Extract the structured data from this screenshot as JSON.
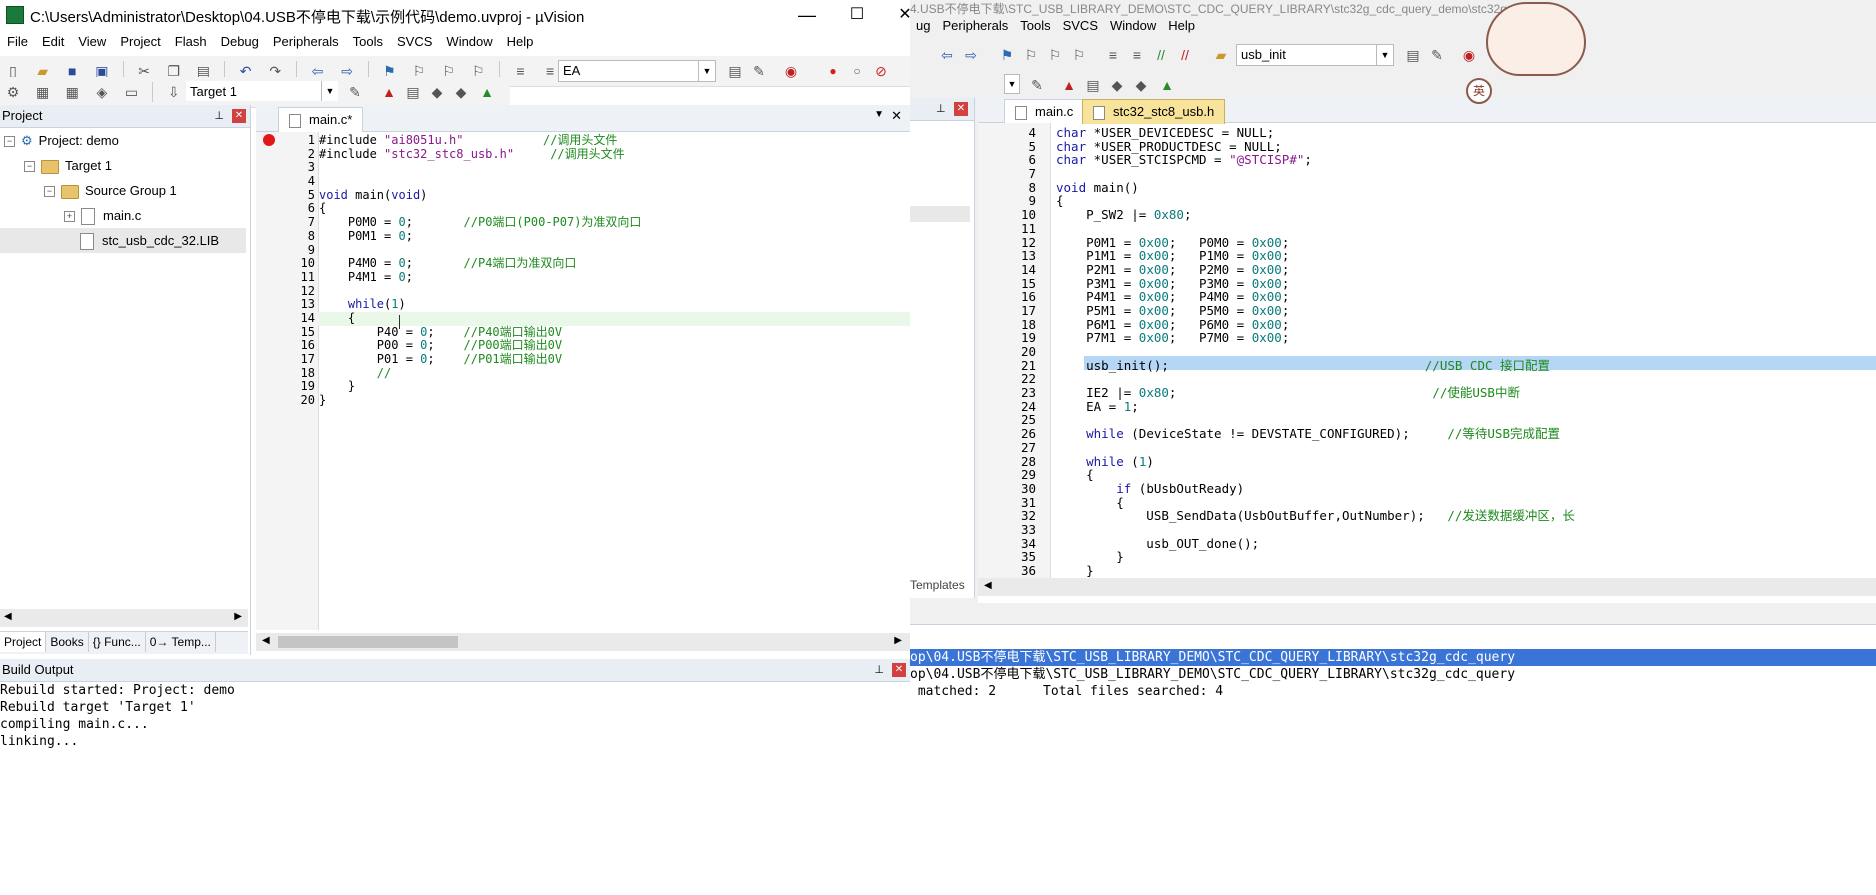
{
  "window": {
    "title": "C:\\Users\\Administrator\\Desktop\\04.USB不停电下载\\示例代码\\demo.uvproj - µVision",
    "minimize": "—",
    "maximize": "☐",
    "close": "✕"
  },
  "menu": [
    "File",
    "Edit",
    "View",
    "Project",
    "Flash",
    "Debug",
    "Peripherals",
    "Tools",
    "SVCS",
    "Window",
    "Help"
  ],
  "toolbar1": {
    "find_value": "EA"
  },
  "toolbar2": {
    "target": "Target 1"
  },
  "project": {
    "title": "Project",
    "root": "Project: demo",
    "target": "Target 1",
    "group": "Source Group 1",
    "files": [
      "main.c",
      "stc_usb_cdc_32.LIB"
    ],
    "bottom_tabs": [
      "Project",
      "Books",
      "{} Func...",
      "0→ Temp..."
    ]
  },
  "editor": {
    "tab": "main.c*",
    "lines": [
      {
        "n": "1",
        "seg": [
          [
            "#include ",
            ""
          ],
          [
            "\"ai8051u.h\"",
            "str"
          ],
          [
            "           //调用头文件",
            "cmt"
          ]
        ]
      },
      {
        "n": "2",
        "seg": [
          [
            "#include ",
            ""
          ],
          [
            "\"stc32_stc8_usb.h\"",
            "str"
          ],
          [
            "     //调用头文件",
            "cmt"
          ]
        ]
      },
      {
        "n": "3",
        "seg": []
      },
      {
        "n": "4",
        "seg": []
      },
      {
        "n": "5",
        "seg": [
          [
            "void",
            "kw"
          ],
          [
            " main(",
            ""
          ],
          [
            "void",
            "kw"
          ],
          [
            ")",
            ""
          ]
        ]
      },
      {
        "n": "6",
        "seg": [
          [
            "{",
            ""
          ]
        ]
      },
      {
        "n": "7",
        "seg": [
          [
            "    P0M0 = ",
            ""
          ],
          [
            "0",
            "num"
          ],
          [
            ";       ",
            ""
          ],
          [
            "//P0端口(P00-P07)为准双向口",
            "cmt"
          ]
        ]
      },
      {
        "n": "8",
        "seg": [
          [
            "    P0M1 = ",
            ""
          ],
          [
            "0",
            "num"
          ],
          [
            ";",
            ""
          ]
        ]
      },
      {
        "n": "9",
        "seg": []
      },
      {
        "n": "10",
        "seg": [
          [
            "    P4M0 = ",
            ""
          ],
          [
            "0",
            "num"
          ],
          [
            ";       ",
            ""
          ],
          [
            "//P4端口为准双向口",
            "cmt"
          ]
        ]
      },
      {
        "n": "11",
        "seg": [
          [
            "    P4M1 = ",
            ""
          ],
          [
            "0",
            "num"
          ],
          [
            ";",
            ""
          ]
        ]
      },
      {
        "n": "12",
        "seg": []
      },
      {
        "n": "13",
        "seg": [
          [
            "    ",
            ""
          ],
          [
            "while",
            "kw"
          ],
          [
            "(",
            ""
          ],
          [
            "1",
            "num"
          ],
          [
            ")",
            ""
          ]
        ]
      },
      {
        "n": "14",
        "seg": [
          [
            "    {",
            ""
          ]
        ]
      },
      {
        "n": "15",
        "seg": [
          [
            "        P40 = ",
            ""
          ],
          [
            "0",
            "num"
          ],
          [
            ";    ",
            ""
          ],
          [
            "//P40端口输出0V",
            "cmt"
          ]
        ]
      },
      {
        "n": "16",
        "seg": [
          [
            "        P00 = ",
            ""
          ],
          [
            "0",
            "num"
          ],
          [
            ";    ",
            ""
          ],
          [
            "//P00端口输出0V",
            "cmt"
          ]
        ]
      },
      {
        "n": "17",
        "seg": [
          [
            "        P01 = ",
            ""
          ],
          [
            "0",
            "num"
          ],
          [
            ";    ",
            ""
          ],
          [
            "//P01端口输出0V",
            "cmt"
          ]
        ]
      },
      {
        "n": "18",
        "seg": [
          [
            "        //",
            "cmt"
          ]
        ]
      },
      {
        "n": "19",
        "seg": [
          [
            "    }",
            ""
          ]
        ]
      },
      {
        "n": "20",
        "seg": [
          [
            "}",
            ""
          ]
        ]
      }
    ]
  },
  "build": {
    "title": "Build Output",
    "lines": [
      "Rebuild started: Project: demo",
      "Rebuild target 'Target 1'",
      "compiling main.c...",
      "linking..."
    ]
  },
  "right": {
    "menu": [
      "ug",
      "Peripherals",
      "Tools",
      "SVCS",
      "Window",
      "Help"
    ],
    "title_partial": "4.USB不停电下载\\STC_USB_LIBRARY_DEMO\\STC_CDC_QUERY_LIBRARY\\stc32g_cdc_query_demo\\stc32g_...",
    "find_value": "usb_init",
    "tabs": [
      "main.c",
      "stc32_stc8_usb.h"
    ],
    "templates_tab": "Templates",
    "mascot_badge1": "英",
    "lines": [
      {
        "n": "4",
        "seg": [
          [
            "char ",
            "kw"
          ],
          [
            "*USER_DEVICEDESC = NULL;",
            ""
          ]
        ]
      },
      {
        "n": "5",
        "seg": [
          [
            "char ",
            "kw"
          ],
          [
            "*USER_PRODUCTDESC = NULL;",
            ""
          ]
        ]
      },
      {
        "n": "6",
        "seg": [
          [
            "char ",
            "kw"
          ],
          [
            "*USER_STCISPCMD = ",
            ""
          ],
          [
            "\"@STCISP#\"",
            "str"
          ],
          [
            ";",
            ""
          ]
        ]
      },
      {
        "n": "7",
        "seg": []
      },
      {
        "n": "8",
        "seg": [
          [
            "void",
            "kw"
          ],
          [
            " main()",
            ""
          ]
        ]
      },
      {
        "n": "9",
        "seg": [
          [
            "{",
            ""
          ]
        ]
      },
      {
        "n": "10",
        "seg": [
          [
            "    P_SW2 |= ",
            ""
          ],
          [
            "0x80",
            "num"
          ],
          [
            ";",
            ""
          ]
        ]
      },
      {
        "n": "11",
        "seg": []
      },
      {
        "n": "12",
        "seg": [
          [
            "    P0M1 = ",
            ""
          ],
          [
            "0x00",
            "num"
          ],
          [
            ";   P0M0 = ",
            ""
          ],
          [
            "0x00",
            "num"
          ],
          [
            ";",
            ""
          ]
        ]
      },
      {
        "n": "13",
        "seg": [
          [
            "    P1M1 = ",
            ""
          ],
          [
            "0x00",
            "num"
          ],
          [
            ";   P1M0 = ",
            ""
          ],
          [
            "0x00",
            "num"
          ],
          [
            ";",
            ""
          ]
        ]
      },
      {
        "n": "14",
        "seg": [
          [
            "    P2M1 = ",
            ""
          ],
          [
            "0x00",
            "num"
          ],
          [
            ";   P2M0 = ",
            ""
          ],
          [
            "0x00",
            "num"
          ],
          [
            ";",
            ""
          ]
        ]
      },
      {
        "n": "15",
        "seg": [
          [
            "    P3M1 = ",
            ""
          ],
          [
            "0x00",
            "num"
          ],
          [
            ";   P3M0 = ",
            ""
          ],
          [
            "0x00",
            "num"
          ],
          [
            ";",
            ""
          ]
        ]
      },
      {
        "n": "16",
        "seg": [
          [
            "    P4M1 = ",
            ""
          ],
          [
            "0x00",
            "num"
          ],
          [
            ";   P4M0 = ",
            ""
          ],
          [
            "0x00",
            "num"
          ],
          [
            ";",
            ""
          ]
        ]
      },
      {
        "n": "17",
        "seg": [
          [
            "    P5M1 = ",
            ""
          ],
          [
            "0x00",
            "num"
          ],
          [
            ";   P5M0 = ",
            ""
          ],
          [
            "0x00",
            "num"
          ],
          [
            ";",
            ""
          ]
        ]
      },
      {
        "n": "18",
        "seg": [
          [
            "    P6M1 = ",
            ""
          ],
          [
            "0x00",
            "num"
          ],
          [
            ";   P6M0 = ",
            ""
          ],
          [
            "0x00",
            "num"
          ],
          [
            ";",
            ""
          ]
        ]
      },
      {
        "n": "19",
        "seg": [
          [
            "    P7M1 = ",
            ""
          ],
          [
            "0x00",
            "num"
          ],
          [
            ";   P7M0 = ",
            ""
          ],
          [
            "0x00",
            "num"
          ],
          [
            ";",
            ""
          ]
        ]
      },
      {
        "n": "20",
        "seg": []
      },
      {
        "n": "21",
        "seg": [
          [
            "    usb_init();                                  ",
            ""
          ],
          [
            "//USB CDC 接口配置",
            "cmt"
          ]
        ],
        "hl": true
      },
      {
        "n": "22",
        "seg": []
      },
      {
        "n": "23",
        "seg": [
          [
            "    IE2 |= ",
            ""
          ],
          [
            "0x80",
            "num"
          ],
          [
            ";                                  ",
            ""
          ],
          [
            "//使能USB中断",
            "cmt"
          ]
        ]
      },
      {
        "n": "24",
        "seg": [
          [
            "    EA = ",
            ""
          ],
          [
            "1",
            "num"
          ],
          [
            ";",
            ""
          ]
        ]
      },
      {
        "n": "25",
        "seg": []
      },
      {
        "n": "26",
        "seg": [
          [
            "    ",
            ""
          ],
          [
            "while",
            "kw"
          ],
          [
            " (DeviceState != DEVSTATE_CONFIGURED);     ",
            ""
          ],
          [
            "//等待USB完成配置",
            "cmt"
          ]
        ]
      },
      {
        "n": "27",
        "seg": []
      },
      {
        "n": "28",
        "seg": [
          [
            "    ",
            ""
          ],
          [
            "while",
            "kw"
          ],
          [
            " (",
            ""
          ],
          [
            "1",
            "num"
          ],
          [
            ")",
            ""
          ]
        ]
      },
      {
        "n": "29",
        "seg": [
          [
            "    {",
            ""
          ]
        ]
      },
      {
        "n": "30",
        "seg": [
          [
            "        ",
            ""
          ],
          [
            "if",
            "kw"
          ],
          [
            " (bUsbOutReady)",
            ""
          ]
        ]
      },
      {
        "n": "31",
        "seg": [
          [
            "        {",
            ""
          ]
        ]
      },
      {
        "n": "32",
        "seg": [
          [
            "            USB_SendData(UsbOutBuffer,OutNumber);   ",
            ""
          ],
          [
            "//发送数据缓冲区，长",
            "cmt"
          ]
        ]
      },
      {
        "n": "33",
        "seg": []
      },
      {
        "n": "34",
        "seg": [
          [
            "            usb_OUT_done();",
            ""
          ]
        ]
      },
      {
        "n": "35",
        "seg": [
          [
            "        }",
            ""
          ]
        ]
      },
      {
        "n": "36",
        "seg": [
          [
            "    }",
            ""
          ]
        ]
      }
    ],
    "find_lines": [
      "op\\04.USB不停电下载\\STC_USB_LIBRARY_DEMO\\STC_CDC_QUERY_LIBRARY\\stc32g_cdc_query",
      "op\\04.USB不停电下载\\STC_USB_LIBRARY_DEMO\\STC_CDC_QUERY_LIBRARY\\stc32g_cdc_query",
      " matched: 2      Total files searched: 4"
    ]
  }
}
